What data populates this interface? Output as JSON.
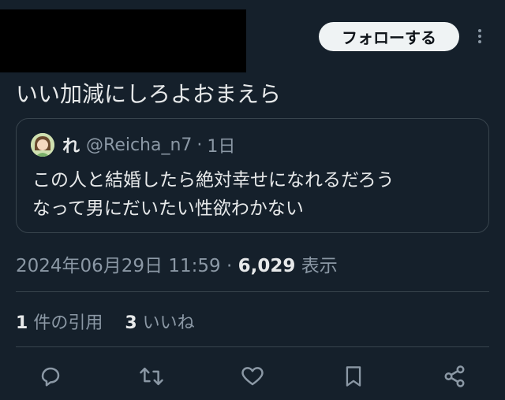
{
  "header": {
    "follow_label": "フォローする"
  },
  "tweet": {
    "text": "いい加減にしろよおまえら"
  },
  "quote": {
    "name": "れ",
    "handle": "@Reicha_n7",
    "separator": "·",
    "time": "1日",
    "line1": "この人と結婚したら絶対幸せになれるだろう",
    "line2": "なって男にだいたい性欲わかない"
  },
  "meta": {
    "datetime": "2024年06月29日 11:59",
    "separator": "·",
    "views": "6,029",
    "views_label": "表示"
  },
  "stats": {
    "quotes_count": "1",
    "quotes_label": "件の引用",
    "likes_count": "3",
    "likes_label": "いいね"
  },
  "icons": [
    "reply-icon",
    "retweet-icon",
    "like-icon",
    "bookmark-icon",
    "share-icon"
  ],
  "colors": {
    "background": "#15202b",
    "text": "#e7e9ea",
    "muted": "#8b98a5",
    "border": "#38444d"
  }
}
